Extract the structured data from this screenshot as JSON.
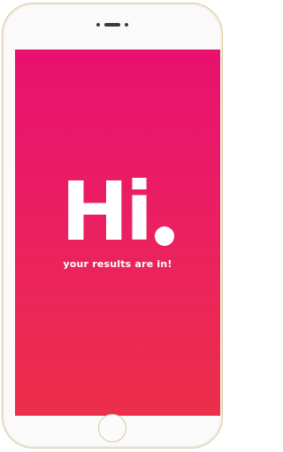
{
  "screen": {
    "greeting": "Hi",
    "subtitle": "your results are in!"
  },
  "colors": {
    "gradient_top": "#e9106f",
    "gradient_bottom": "#ec2f4a",
    "text": "#ffffff",
    "phone_frame": "#d8c79e"
  },
  "icons": {
    "speaker": "speaker-grille-icon",
    "home": "home-button-icon"
  }
}
